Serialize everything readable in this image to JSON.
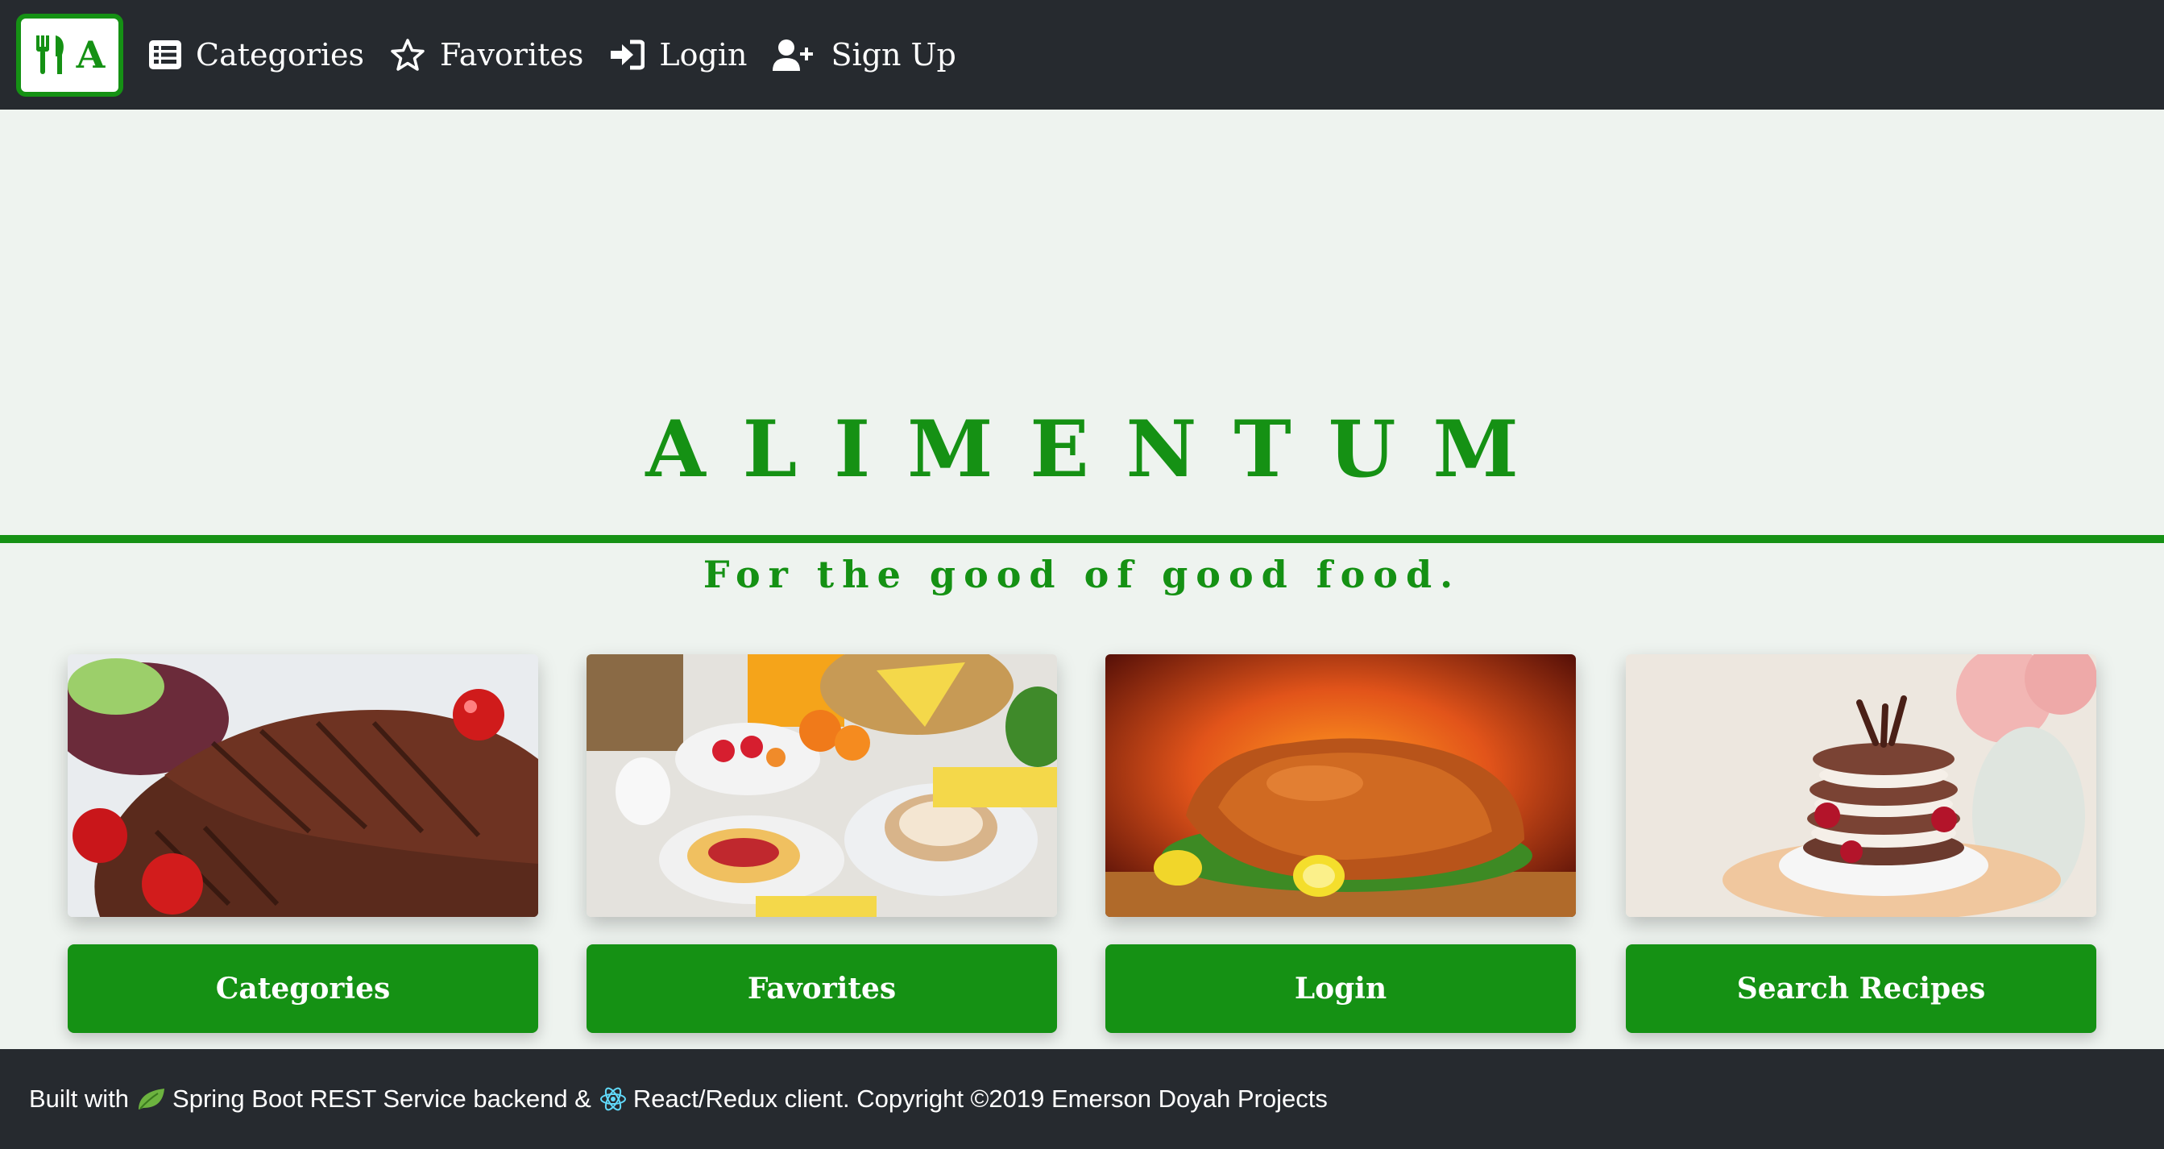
{
  "brand": {
    "letter": "A",
    "icon": "utensils-icon"
  },
  "nav": [
    {
      "label": "Categories",
      "icon": "list-icon"
    },
    {
      "label": "Favorites",
      "icon": "star-icon"
    },
    {
      "label": "Login",
      "icon": "sign-in-icon"
    },
    {
      "label": "Sign Up",
      "icon": "user-plus-icon"
    }
  ],
  "hero": {
    "title": "ALIMENTUM",
    "subtitle": "For the good of good food."
  },
  "cards": [
    {
      "button": "Categories",
      "image": "grilled-steak-image"
    },
    {
      "button": "Favorites",
      "image": "breakfast-spread-image"
    },
    {
      "button": "Login",
      "image": "roast-chicken-image"
    },
    {
      "button": "Search Recipes",
      "image": "chocolate-dessert-image"
    }
  ],
  "footer": {
    "part1": "Built with",
    "part2": "Spring Boot REST Service backend &",
    "part3": "React/Redux client. Copyright ©2019 Emerson Doyah Projects",
    "spring_icon": "leaf-icon",
    "react_icon": "react-atom-icon"
  },
  "colors": {
    "accent": "#159114",
    "navbar": "#262a2f",
    "background": "#eef3ef"
  }
}
